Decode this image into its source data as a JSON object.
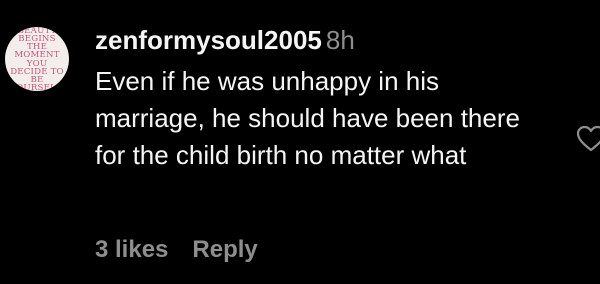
{
  "comment": {
    "avatar_text": "BEAUTY BEGINS THE MOMENT YOU DECIDE TO BE YOURSELF.",
    "username": "zenformysoul2005",
    "time": "8h",
    "body": "Even if he was unhappy in his marriage, he should have been there for the child birth no matter what",
    "likes": "3 likes",
    "reply": "Reply"
  },
  "icons": {
    "like": "heart-outline-icon"
  },
  "colors": {
    "background": "#000000",
    "text": "#f5f5f5",
    "muted": "#8e8e8e",
    "avatar_text": "#c0587a"
  }
}
